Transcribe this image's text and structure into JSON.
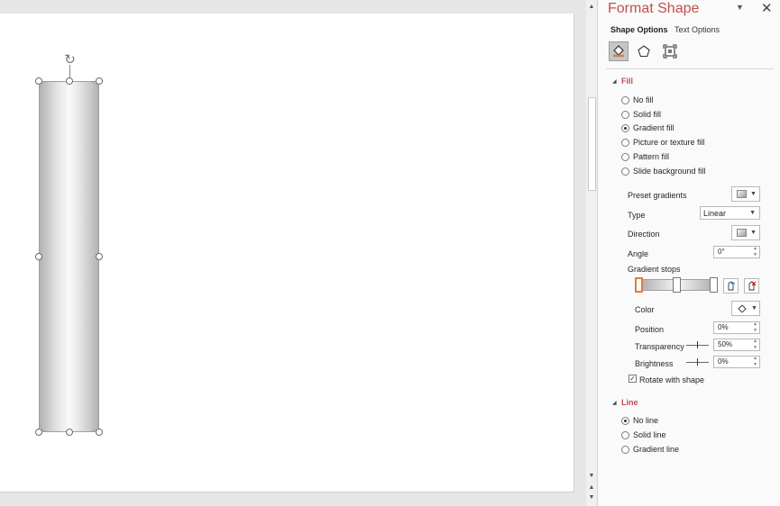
{
  "pane": {
    "title": "Format Shape",
    "tabs": [
      {
        "label": "Shape Options",
        "active": true
      },
      {
        "label": "Text Options",
        "active": false
      }
    ],
    "categories": [
      "fill-line-icon",
      "effects-icon",
      "size-properties-icon"
    ],
    "fill": {
      "header": "Fill",
      "options": [
        {
          "label": "No fill",
          "selected": false
        },
        {
          "label": "Solid fill",
          "selected": false
        },
        {
          "label": "Gradient fill",
          "selected": true
        },
        {
          "label": "Picture or texture fill",
          "selected": false
        },
        {
          "label": "Pattern fill",
          "selected": false
        },
        {
          "label": "Slide background fill",
          "selected": false
        }
      ],
      "preset_label": "Preset gradients",
      "type_label": "Type",
      "type_value": "Linear",
      "direction_label": "Direction",
      "angle_label": "Angle",
      "angle_value": "0°",
      "stops_label": "Gradient stops",
      "color_label": "Color",
      "position_label": "Position",
      "position_value": "0%",
      "transparency_label": "Transparency",
      "transparency_value": "50%",
      "brightness_label": "Brightness",
      "brightness_value": "0%",
      "rotate_label": "Rotate with shape",
      "rotate_checked": true
    },
    "line": {
      "header": "Line",
      "options": [
        {
          "label": "No line",
          "selected": true
        },
        {
          "label": "Solid line",
          "selected": false
        },
        {
          "label": "Gradient line",
          "selected": false
        }
      ]
    }
  },
  "colors": {
    "accent": "#c0504d",
    "stop_selected": "#e07b3c"
  }
}
